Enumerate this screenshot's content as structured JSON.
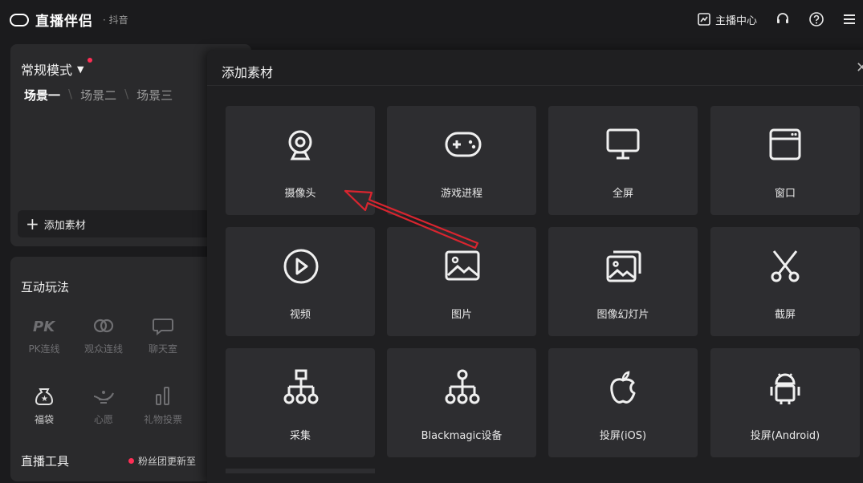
{
  "app": {
    "name": "直播伴侣",
    "platform": "· 抖音"
  },
  "topbar": {
    "streamer_center": "主播中心"
  },
  "scene_panel": {
    "mode": "常规模式",
    "scenes": [
      "场景一",
      "场景二",
      "场景三"
    ],
    "add_material": "添加素材"
  },
  "interaction": {
    "title": "互动玩法",
    "tools": [
      {
        "label": "PK连线",
        "icon": "pk-icon",
        "enabled": false
      },
      {
        "label": "观众连线",
        "icon": "link-icon",
        "enabled": false
      },
      {
        "label": "聊天室",
        "icon": "chat-room-icon",
        "enabled": false
      },
      {
        "label": "福袋",
        "icon": "lucky-bag-icon",
        "enabled": true
      },
      {
        "label": "心愿",
        "icon": "magic-lamp-icon",
        "enabled": false
      },
      {
        "label": "礼物投票",
        "icon": "vote-bars-icon",
        "enabled": false
      }
    ]
  },
  "live_tools": {
    "title": "直播工具",
    "fan_club_notice": "粉丝团更新至"
  },
  "modal": {
    "title": "添加素材",
    "items": [
      {
        "label": "摄像头",
        "icon": "camera-icon"
      },
      {
        "label": "游戏进程",
        "icon": "gamepad-icon"
      },
      {
        "label": "全屏",
        "icon": "monitor-icon"
      },
      {
        "label": "窗口",
        "icon": "window-icon"
      },
      {
        "label": "视频",
        "icon": "play-icon"
      },
      {
        "label": "图片",
        "icon": "image-icon"
      },
      {
        "label": "图像幻灯片",
        "icon": "slideshow-icon"
      },
      {
        "label": "截屏",
        "icon": "scissors-icon"
      },
      {
        "label": "采集",
        "icon": "capture-tree-icon"
      },
      {
        "label": "Blackmagic设备",
        "icon": "blackmagic-tree-icon"
      },
      {
        "label": "投屏(iOS)",
        "icon": "apple-icon"
      },
      {
        "label": "投屏(Android)",
        "icon": "android-icon"
      }
    ]
  },
  "colors": {
    "accent": "#ff2e55",
    "annotation_arrow": "#d9252f",
    "tile_bg": "#2d2d30"
  }
}
